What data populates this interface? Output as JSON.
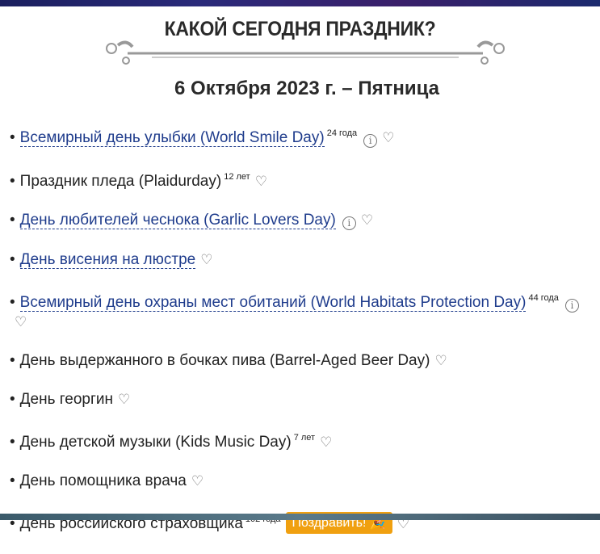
{
  "header": {
    "title": "КАКОЙ СЕГОДНЯ ПРАЗДНИК?",
    "date": "6 Октября 2023 г. – Пятница"
  },
  "holidays": [
    {
      "name": "Всемирный день улыбки (World Smile Day)",
      "age": "24 года",
      "link": true,
      "info": true
    },
    {
      "name": "Праздник пледа (Plaidurday)",
      "age": "12 лет",
      "link": false,
      "info": false
    },
    {
      "name": "День любителей чеснока (Garlic Lovers Day)",
      "age": null,
      "link": true,
      "info": true
    },
    {
      "name": "День висения на люстре",
      "age": null,
      "link": true,
      "info": false
    },
    {
      "name": "Всемирный день охраны мест обитаний (World Habitats Protection Day)",
      "age": "44 года",
      "link": true,
      "info": true
    },
    {
      "name": "День выдержанного в бочках пива (Barrel-Aged Beer Day)",
      "age": null,
      "link": false,
      "info": false
    },
    {
      "name": "День георгин",
      "age": null,
      "link": false,
      "info": false
    },
    {
      "name": "День детской музыки (Kids Music Day)",
      "age": "7 лет",
      "link": false,
      "info": false
    },
    {
      "name": "День помощника врача",
      "age": null,
      "link": false,
      "info": false
    },
    {
      "name": "День российского страховщика",
      "age": "102 года",
      "link": false,
      "info": false,
      "button": "Поздравить!"
    }
  ],
  "icons": {
    "bullet": "•",
    "info": "i",
    "heart": "♡",
    "party": "🎉"
  },
  "colors": {
    "link": "#1f3c8c",
    "button": "#f0a010"
  }
}
